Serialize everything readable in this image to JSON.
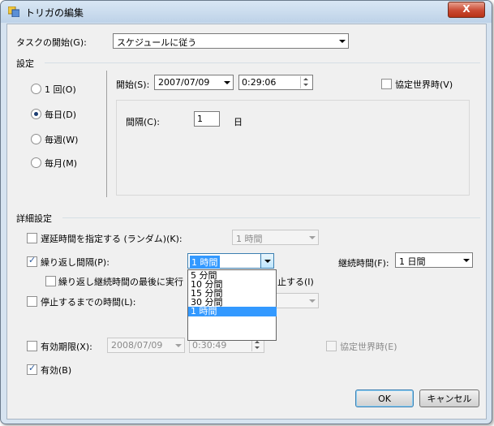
{
  "window": {
    "title": "トリガの編集",
    "close_label": "X"
  },
  "task_start": {
    "label": "タスクの開始(G):",
    "value": "スケジュールに従う"
  },
  "settings": {
    "group_label": "設定",
    "radios": [
      {
        "label": "1 回(O)",
        "checked": false
      },
      {
        "label": "毎日(D)",
        "checked": true
      },
      {
        "label": "毎週(W)",
        "checked": false
      },
      {
        "label": "毎月(M)",
        "checked": false
      }
    ],
    "start_label": "開始(S):",
    "start_date": "2007/07/09",
    "start_time": "0:29:06",
    "utc_label": "協定世界時(V)",
    "interval_label": "間隔(C):",
    "interval_value": "1",
    "interval_unit": "日"
  },
  "advanced": {
    "group_label": "詳細設定",
    "delay": {
      "label": "遅延時間を指定する (ランダム)(K):",
      "checked": false,
      "value": "1 時間"
    },
    "repeat": {
      "label": "繰り返し間隔(P):",
      "checked": true,
      "value": "1 時間"
    },
    "duration": {
      "label": "継続時間(F):",
      "value": "1 日間"
    },
    "stop_at_end": {
      "label_left": "繰り返し継続時間の最後に実行",
      "label_right": "止する(I)",
      "checked": false
    },
    "stop_after": {
      "label": "停止するまでの時間(L):",
      "checked": false
    },
    "repeat_options": [
      {
        "label": "5 分間",
        "selected": false
      },
      {
        "label": "10 分間",
        "selected": false
      },
      {
        "label": "15 分間",
        "selected": false
      },
      {
        "label": "30 分間",
        "selected": false
      },
      {
        "label": "1 時間",
        "selected": true
      }
    ],
    "expire": {
      "label": "有効期限(X):",
      "checked": false,
      "date": "2008/07/09",
      "time": "0:30:49",
      "utc_label": "協定世界時(E)"
    },
    "enabled": {
      "label": "有効(B)",
      "checked": true
    }
  },
  "buttons": {
    "ok": "OK",
    "cancel": "キャンセル"
  }
}
